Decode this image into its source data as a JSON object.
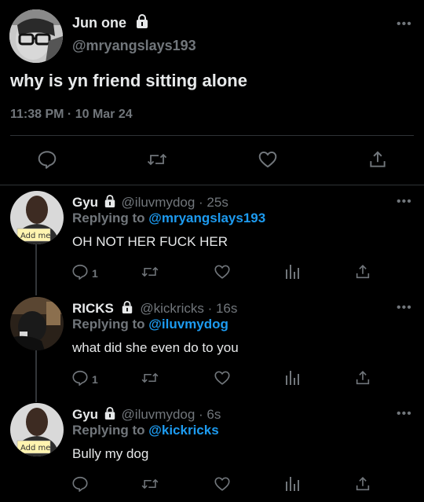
{
  "main_tweet": {
    "display_name": "Jun one",
    "handle": "@mryangslays193",
    "text": "why is yn friend sitting alone",
    "time": "11:38 PM · 10 Mar 24"
  },
  "replies": [
    {
      "display_name": "Gyu",
      "handle_time": "@iluvmydog · 25s",
      "replying_prefix": "Replying to",
      "replying_to": "@mryangslays193",
      "text": "OH NOT HER FUCK HER",
      "reply_count": "1",
      "avatar_note": "Add me"
    },
    {
      "display_name": "RICKS",
      "handle_time": "@kickricks · 16s",
      "replying_prefix": "Replying to",
      "replying_to": "@iluvmydog",
      "text": "what did she even do to you",
      "reply_count": "1"
    },
    {
      "display_name": "Gyu",
      "handle_time": "@iluvmydog · 6s",
      "replying_prefix": "Replying to",
      "replying_to": "@kickricks",
      "text": "Bully my dog",
      "reply_count": "",
      "avatar_note": "Add me"
    }
  ],
  "icons": {
    "more": "more-horizontal-icon",
    "lock": "lock-icon",
    "reply": "reply-icon",
    "retweet": "retweet-icon",
    "like": "heart-icon",
    "analytics": "analytics-icon",
    "share": "share-icon"
  },
  "colors": {
    "background": "#000000",
    "text": "#e7e9ea",
    "muted": "#71767b",
    "link": "#1d9bf0",
    "divider": "#2f3336"
  }
}
